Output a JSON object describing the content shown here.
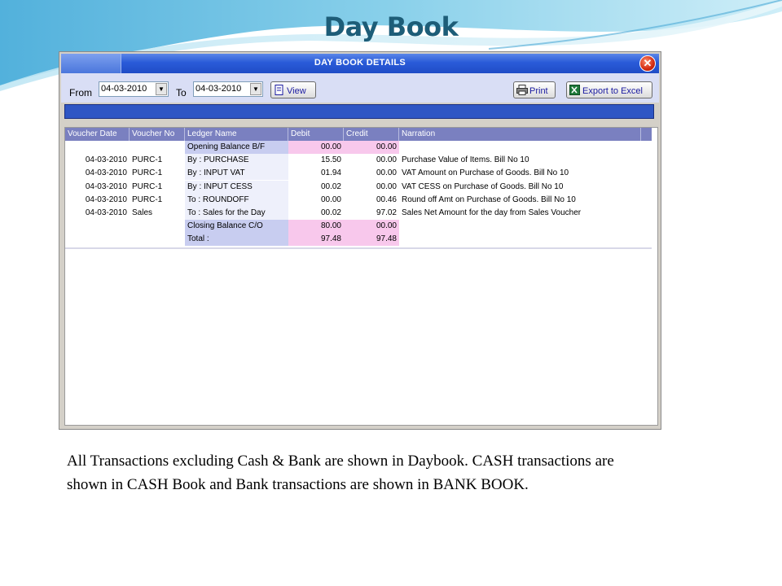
{
  "slide": {
    "title": "Day Book",
    "caption": "All Transactions excluding Cash & Bank are shown in Daybook. CASH transactions are shown in CASH Book and Bank transactions are shown in BANK BOOK."
  },
  "window": {
    "title": "DAY BOOK DETAILS",
    "close_icon": "close-icon",
    "close_glyph": "✕"
  },
  "toolbar": {
    "from_label": "From",
    "from_value": "04-03-2010",
    "to_label": "To",
    "to_value": "04-03-2010",
    "dropdown_glyph": "▼",
    "view_label": "View",
    "print_label": "Print",
    "export_label": "Export to Excel"
  },
  "table": {
    "columns": [
      "Voucher Date",
      "Voucher No",
      "Ledger Name",
      "Debit",
      "Credit",
      "Narration"
    ],
    "rows": [
      {
        "date": "",
        "voucher": "",
        "ledger": "Opening Balance B/F",
        "debit": "00.00",
        "credit": "00.00",
        "narration": "",
        "kind": "balance"
      },
      {
        "date": "04-03-2010",
        "voucher": "PURC-1",
        "ledger": "By : PURCHASE",
        "debit": "15.50",
        "credit": "00.00",
        "narration": "Purchase Value of Items. Bill No 10",
        "kind": "normal"
      },
      {
        "date": "04-03-2010",
        "voucher": "PURC-1",
        "ledger": "By : INPUT VAT",
        "debit": "01.94",
        "credit": "00.00",
        "narration": "VAT Amount on Purchase of Goods. Bill No 10",
        "kind": "normal"
      },
      {
        "date": "04-03-2010",
        "voucher": "PURC-1",
        "ledger": "By : INPUT CESS",
        "debit": "00.02",
        "credit": "00.00",
        "narration": "VAT CESS on Purchase of Goods. Bill No 10",
        "kind": "normal"
      },
      {
        "date": "04-03-2010",
        "voucher": "PURC-1",
        "ledger": "To : ROUNDOFF",
        "debit": "00.00",
        "credit": "00.46",
        "narration": "Round off Amt on Purchase of Goods. Bill No 10",
        "kind": "normal"
      },
      {
        "date": "04-03-2010",
        "voucher": "Sales",
        "ledger": "To : Sales for the Day",
        "debit": "00.02",
        "credit": "97.02",
        "narration": "Sales Net Amount for the day from Sales Voucher",
        "kind": "normal"
      },
      {
        "date": "",
        "voucher": "",
        "ledger": "Closing Balance C/O",
        "debit": "80.00",
        "credit": "00.00",
        "narration": "",
        "kind": "balance"
      },
      {
        "date": "",
        "voucher": "",
        "ledger": "Total :",
        "debit": "97.48",
        "credit": "97.48",
        "narration": "",
        "kind": "total"
      }
    ]
  },
  "colors": {
    "title": "#1d5d78",
    "balance_ledger": "#c8cdf0",
    "balance_amount": "#f8c8ec",
    "total_ledger": "#c8cdf0",
    "total_amount": "#f8c8ec",
    "normal_ledger": "#eef0fb"
  }
}
